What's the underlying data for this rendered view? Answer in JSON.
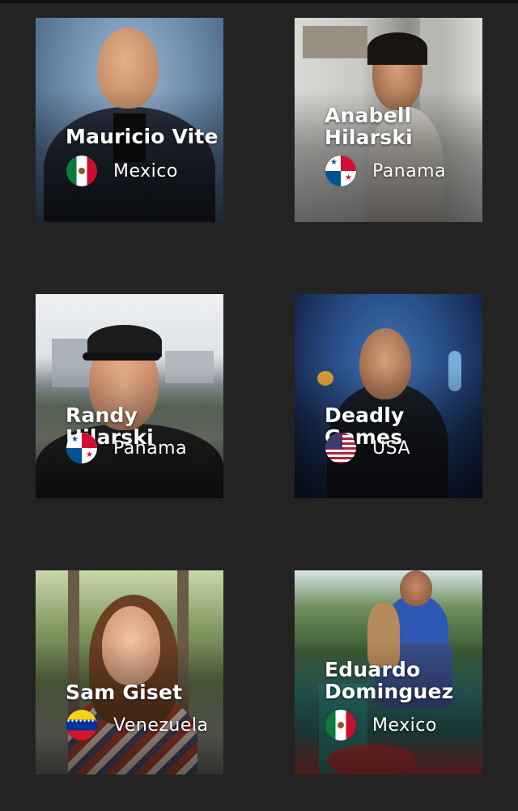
{
  "profiles": [
    {
      "name": "Mauricio Vite",
      "country": "Mexico",
      "flag": "flag-mexico-icon"
    },
    {
      "name": "Anabell Hilarski",
      "country": "Panama",
      "flag": "flag-panama-icon"
    },
    {
      "name": "Randy Hilarski",
      "country": "Panama",
      "flag": "flag-panama-icon"
    },
    {
      "name": "Deadly Games",
      "country": "USA",
      "flag": "flag-usa-icon"
    },
    {
      "name": "Sam Giset",
      "country": "Venezuela",
      "flag": "flag-venezuela-icon"
    },
    {
      "name": "Eduardo Dominguez",
      "country": "Mexico",
      "flag": "flag-mexico-icon"
    }
  ],
  "colors": {
    "background": "#232323",
    "text": "#ffffff"
  }
}
